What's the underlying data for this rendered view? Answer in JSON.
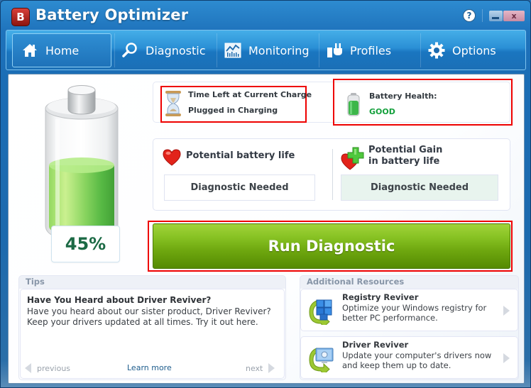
{
  "window": {
    "title": "Battery Optimizer",
    "logo_letter": "B",
    "help_label": "?",
    "close_label": "x"
  },
  "nav": {
    "items": [
      {
        "label": "Home",
        "icon": "home-icon",
        "active": true
      },
      {
        "label": "Diagnostic",
        "icon": "magnifier-icon",
        "active": false
      },
      {
        "label": "Monitoring",
        "icon": "chart-icon",
        "active": false
      },
      {
        "label": "Profiles",
        "icon": "plug-icon",
        "active": false
      },
      {
        "label": "Options",
        "icon": "gear-icon",
        "active": false
      }
    ]
  },
  "battery": {
    "charge_percent": 45,
    "charge_label": "45%"
  },
  "status": {
    "time_left_label": "Time Left at Current Charge",
    "time_left_value": "Plugged in Charging",
    "health_label": "Battery Health:",
    "health_value": "GOOD",
    "health_color": "#14a03c"
  },
  "potential": {
    "life_title": "Potential battery life",
    "life_value": "Diagnostic Needed",
    "gain_title_line1": "Potential Gain",
    "gain_title_line2": "in battery life",
    "gain_value": "Diagnostic Needed"
  },
  "run_button": {
    "label": "Run Diagnostic",
    "color": "#6ea70f"
  },
  "tips": {
    "header": "Tips",
    "title": "Have You Heard about Driver Reviver?",
    "body": "Have you heard about our sister product, Driver Reviver? Keep your drivers updated at all times. Try it out here.",
    "previous_label": "previous",
    "learn_more_label": "Learn more",
    "next_label": "next"
  },
  "resources": {
    "header": "Additional Resources",
    "items": [
      {
        "title": "Registry Reviver",
        "description": "Optimize your Windows registry for better PC performance."
      },
      {
        "title": "Driver Reviver",
        "description": "Update your computer's drivers now and keep them up to date."
      }
    ]
  }
}
